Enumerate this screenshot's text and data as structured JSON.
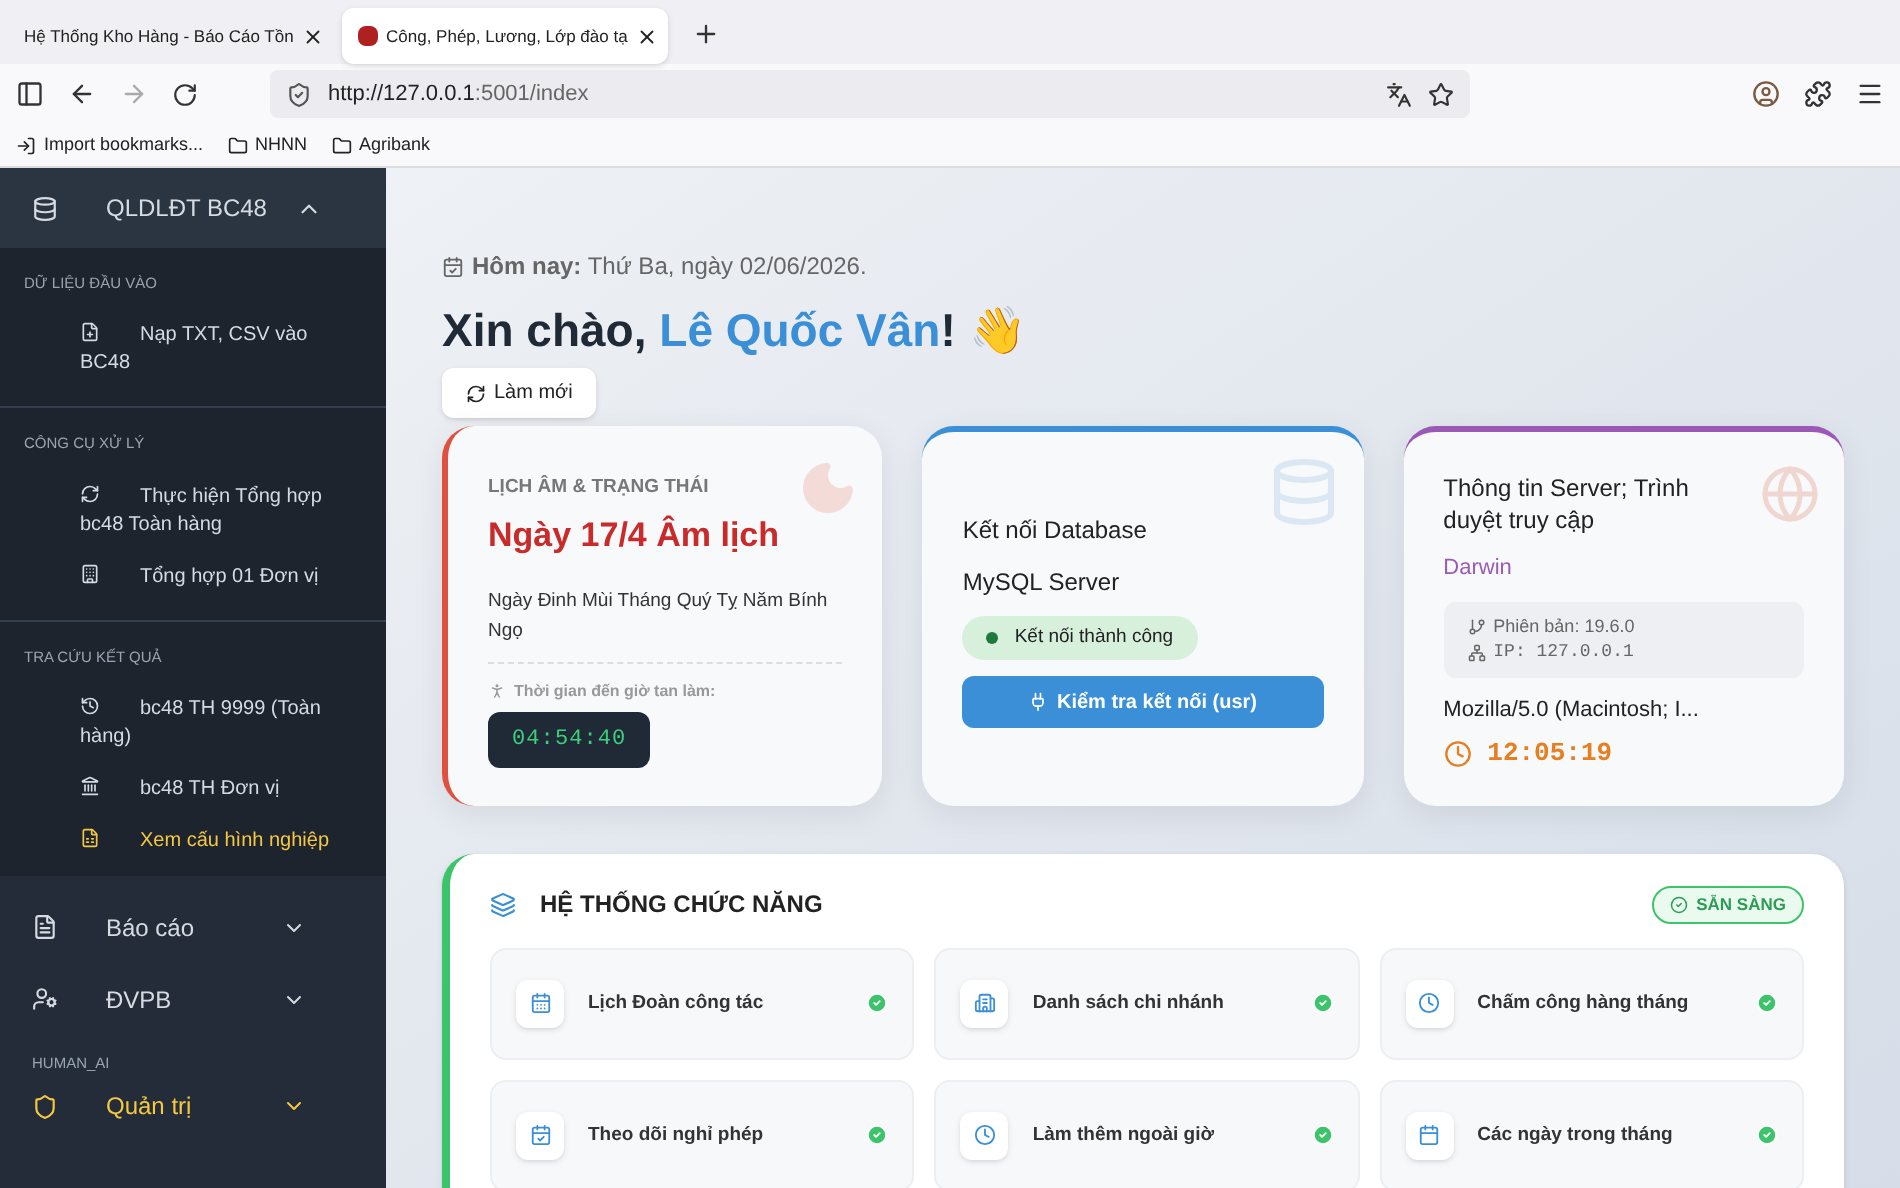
{
  "browser": {
    "tabs": [
      {
        "title": "Hệ Thống Kho Hàng - Báo Cáo Tồn",
        "selected": false
      },
      {
        "title": "Công, Phép, Lương, Lớp đào tạ",
        "selected": true
      }
    ],
    "url_host": "http://127.0.0.1",
    "url_rest": ":5001/index",
    "bookmarks": [
      {
        "label": "Import bookmarks...",
        "kind": "import"
      },
      {
        "label": "NHNN",
        "kind": "folder"
      },
      {
        "label": "Agribank",
        "kind": "folder"
      }
    ]
  },
  "sidebar": {
    "title": "QLDLĐT BC48",
    "expanded": true,
    "groups": [
      {
        "heading": "DỮ LIỆU ĐẦU VÀO",
        "items": [
          {
            "label": "Nạp TXT, CSV vào BC48",
            "active": false
          }
        ]
      },
      {
        "heading": "CÔNG CỤ XỬ LÝ",
        "items": [
          {
            "label": "Thực hiện Tổng hợp bc48 Toàn hàng",
            "active": false
          },
          {
            "label": "Tổng hợp 01 Đơn vị",
            "active": false
          }
        ]
      },
      {
        "heading": "TRA CỨU KẾT QUẢ",
        "items": [
          {
            "label": "bc48 TH 9999 (Toàn hàng)",
            "active": false
          },
          {
            "label": "bc48 TH Đơn vị",
            "active": false
          },
          {
            "label": "Xem cấu hình nghiệp",
            "active": true
          }
        ]
      }
    ],
    "menus": [
      {
        "label": "Báo cáo",
        "active": false
      },
      {
        "label": "ĐVPB",
        "active": false
      }
    ],
    "section": "HUMAN_AI",
    "admin_menu": {
      "label": "Quản trị",
      "active": true
    }
  },
  "main": {
    "today_label": "Hôm nay:",
    "today_value": "Thứ Ba, ngày 02/06/2026.",
    "greeting": "Xin chào,",
    "user_name": "Lê Quốc Vân",
    "greeting_end": "! 👋",
    "refresh_button": "Làm mới",
    "lunar_card": {
      "heading": "LỊCH ÂM & TRẠNG THÁI",
      "date": "Ngày 17/4 Âm lịch",
      "detail": "Ngày Đinh Mùi Tháng Quý Tỵ Năm Bính Ngọ",
      "countdown_label": "Thời gian đến giờ tan làm:",
      "countdown": "04:54:40"
    },
    "database_card": {
      "title": "Kết nối Database",
      "server": "MySQL Server",
      "status": "Kết nối thành công",
      "connected": true,
      "button": "Kiểm tra kết nối (usr)"
    },
    "server_card": {
      "title": "Thông tin Server; Trình duyệt truy cập",
      "os": "Darwin",
      "version": "Phiên bản: 19.6.0",
      "ip": "IP: 127.0.0.1",
      "user_agent": "Mozilla/5.0 (Macintosh; I...",
      "time": "12:05:19"
    },
    "functions": {
      "title": "HỆ THỐNG CHỨC NĂNG",
      "badge": "SẴN SÀNG",
      "items": [
        {
          "label": "Lịch Đoàn công tác",
          "ready": true
        },
        {
          "label": "Danh sách chi nhánh",
          "ready": true
        },
        {
          "label": "Chấm công hàng tháng",
          "ready": true
        },
        {
          "label": "Theo dõi nghỉ phép",
          "ready": true
        },
        {
          "label": "Làm thêm ngoài giờ",
          "ready": true
        },
        {
          "label": "Các ngày trong tháng",
          "ready": true
        }
      ]
    }
  }
}
